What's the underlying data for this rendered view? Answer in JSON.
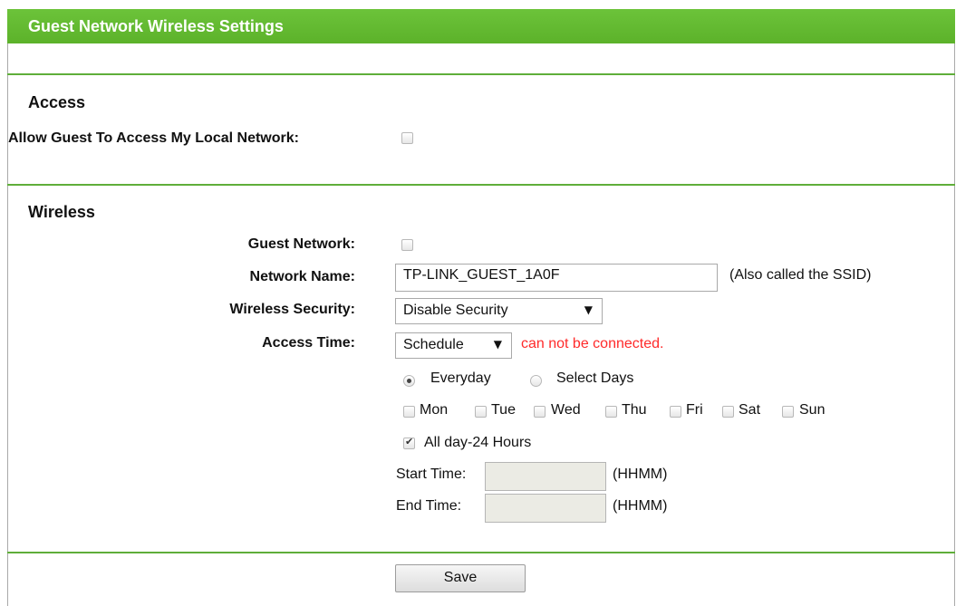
{
  "header": {
    "title": "Guest Network Wireless Settings"
  },
  "access": {
    "section_title": "Access",
    "allow_label": "Allow Guest To Access My Local Network:",
    "allow_checked": false
  },
  "wireless": {
    "section_title": "Wireless",
    "guest_network_label": "Guest Network:",
    "guest_network_checked": false,
    "network_name_label": "Network Name:",
    "network_name_value": "TP-LINK_GUEST_1A0F",
    "ssid_note": "(Also called the SSID)",
    "security_label": "Wireless Security:",
    "security_value": "Disable Security",
    "access_time_label": "Access Time:",
    "access_time_value": "Schedule",
    "access_time_warning": "can not be connected.",
    "radio_everyday": "Everyday",
    "radio_select_days": "Select Days",
    "selected_radio": "Everyday",
    "days": [
      "Mon",
      "Tue",
      "Wed",
      "Thu",
      "Fri",
      "Sat",
      "Sun"
    ],
    "all_day_label": "All day-24 Hours",
    "all_day_checked": true,
    "start_time_label": "Start Time:",
    "start_time_value": "",
    "end_time_label": "End Time:",
    "end_time_value": "",
    "time_format": "(HHMM)"
  },
  "actions": {
    "save_label": "Save"
  },
  "colors": {
    "header_green": "#62b82f",
    "divider_green": "#5fae3a",
    "warning_red": "#ff2a2a"
  }
}
